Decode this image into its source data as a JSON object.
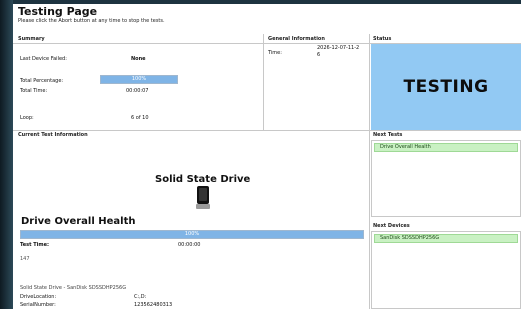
{
  "page": {
    "title": "Testing Page",
    "subtitle": "Please click the Abort button at any time to stop the tests."
  },
  "summary": {
    "heading": "Summary",
    "last_failed_label": "Last Device Failed:",
    "last_failed_value": "None",
    "total_percentage_label": "Total Percentage:",
    "total_percentage_value": "100%",
    "total_percentage_fraction": 1.0,
    "total_time_label": "Total Time:",
    "total_time_value": "00:00:07",
    "loop_label": "Loop:",
    "loop_value": "6 of 10"
  },
  "general": {
    "heading": "General Information",
    "time_label": "Time:",
    "time_value_line1": "2026-12-07-11-2",
    "time_value_line2": "6"
  },
  "status": {
    "heading": "Status",
    "value": "TESTING",
    "color": "#92c9f3"
  },
  "current_test": {
    "heading": "Current Test Information",
    "device_title": "Solid State Drive",
    "device_icon": "ssd-drive-icon",
    "test_title": "Drive Overall Health",
    "progress_value": "100%",
    "progress_fraction": 1.0,
    "test_time_label": "Test Time:",
    "test_time_value": "00:00:00",
    "extra": "147",
    "device_line": "Solid State Drive - SanDisk SDSSDHP256G",
    "drive_location_label": "DriveLocation:",
    "drive_location_value": "C:,D:",
    "serial_label": "SerialNumber:",
    "serial_value": "123562480313"
  },
  "next_tests": {
    "heading": "Next Tests",
    "items": [
      "Drive Overall Health"
    ]
  },
  "next_devices": {
    "heading": "Next Devices",
    "items": [
      "SanDisk SDSSDHP256G"
    ]
  },
  "colors": {
    "progress": "#7fb4e6",
    "list_item": "#c9f1c3"
  }
}
